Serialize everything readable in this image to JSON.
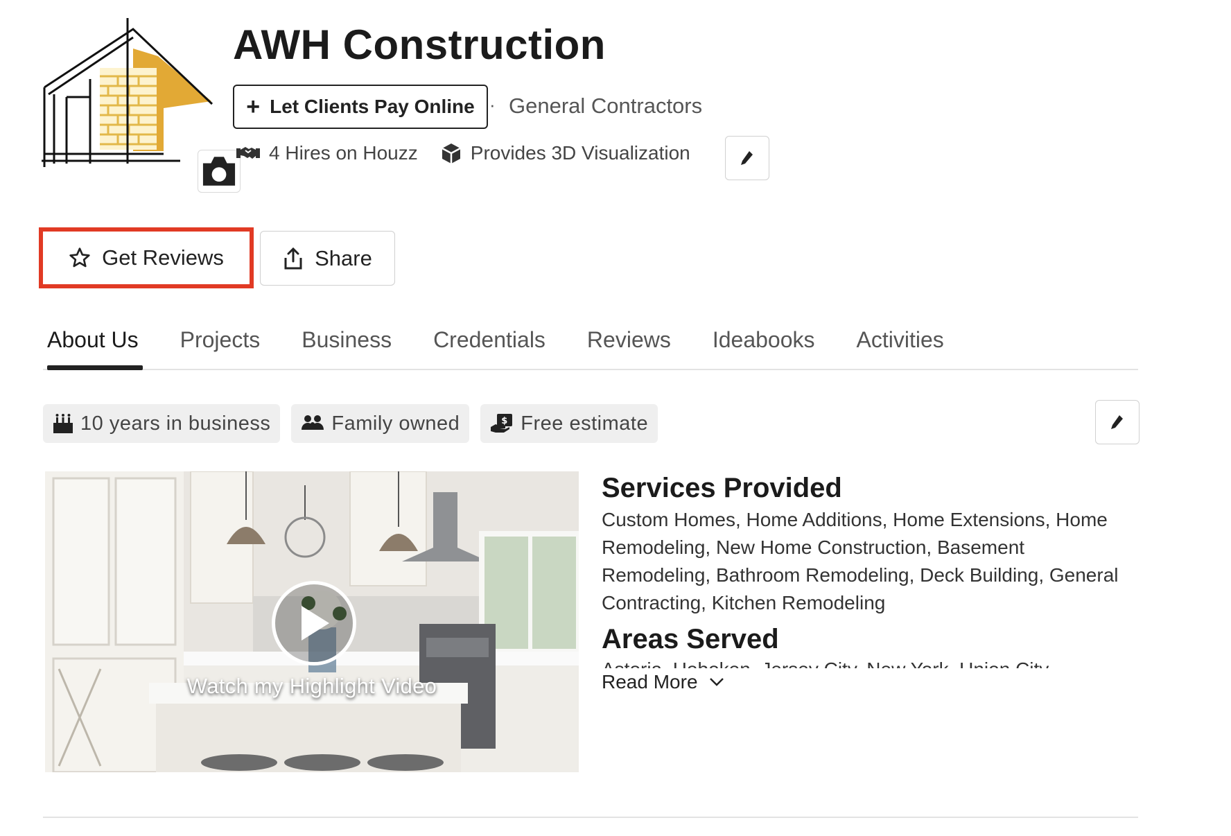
{
  "header": {
    "business_name": "AWH Construction",
    "pay_online_label": "Let Clients Pay Online",
    "separator": "·",
    "category": "General Contractors",
    "hires": "4 Hires on Houzz",
    "visualization": "Provides 3D Visualization"
  },
  "actions": {
    "get_reviews_label": "Get Reviews",
    "share_label": "Share"
  },
  "tabs": [
    {
      "label": "About Us",
      "active": true
    },
    {
      "label": "Projects",
      "active": false
    },
    {
      "label": "Business",
      "active": false
    },
    {
      "label": "Credentials",
      "active": false
    },
    {
      "label": "Reviews",
      "active": false
    },
    {
      "label": "Ideabooks",
      "active": false
    },
    {
      "label": "Activities",
      "active": false
    }
  ],
  "badges": [
    {
      "label": "10 years in business",
      "icon": "cake-icon"
    },
    {
      "label": "Family owned",
      "icon": "family-icon"
    },
    {
      "label": "Free estimate",
      "icon": "estimate-icon"
    }
  ],
  "video": {
    "caption": "Watch my Highlight Video"
  },
  "about": {
    "services_title": "Services Provided",
    "services_text": "Custom Homes, Home Additions, Home Extensions, Home Remodeling, New Home Construction, Basement Remodeling, Bathroom Remodeling, Deck Building, General Contracting, Kitchen Remodeling",
    "areas_title": "Areas Served",
    "areas_text": "Astoria, Hoboken, Jersey City, New York, Union City",
    "read_more_label": "Read More"
  },
  "colors": {
    "highlight_border": "#e13a24",
    "logo_gold": "#e2a935",
    "text_dark": "#1b1b1b",
    "badge_bg": "#efefef"
  }
}
